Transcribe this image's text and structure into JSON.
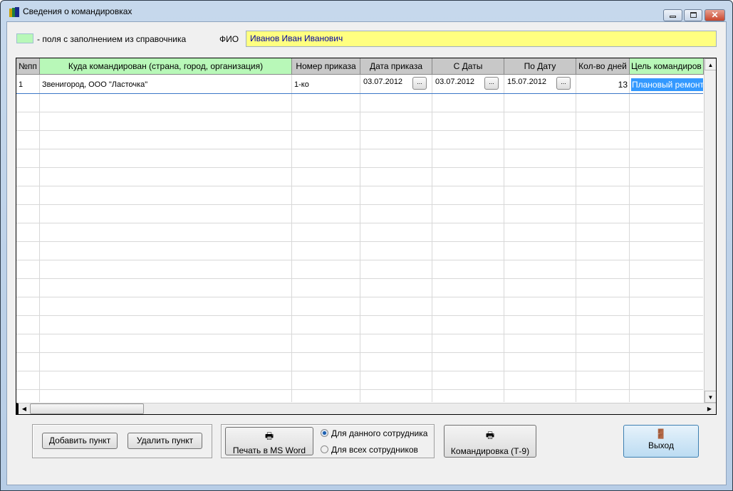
{
  "window": {
    "title": "Сведения о командировках"
  },
  "legend": {
    "text": "- поля с заполнением из справочника",
    "color": "#b8f8b8"
  },
  "fio": {
    "label": "ФИО",
    "value": "Иванов Иван Иванович"
  },
  "table": {
    "columns": [
      "№пп",
      "Куда командирован (страна, город, организация)",
      "Номер приказа",
      "Дата приказа",
      "С Даты",
      "По Дату",
      "Кол-во дней",
      "Цель командиров"
    ],
    "rows": [
      {
        "num": "1",
        "destination": "Звенигород, ООО \"Ласточка\"",
        "order_no": "1-ко",
        "order_date": "03.07.2012",
        "from": "03.07.2012",
        "to": "15.07.2012",
        "days": "13",
        "purpose": "Плановый ремонт"
      }
    ],
    "date_button": "..."
  },
  "buttons": {
    "add": "Добавить пункт",
    "delete": "Удалить пункт",
    "print_word": "Печать в MS Word",
    "t9": "Командировка (Т-9)",
    "exit": "Выход"
  },
  "radios": {
    "this": "Для данного сотрудника",
    "all": "Для всех сотрудников",
    "selected": "this"
  }
}
